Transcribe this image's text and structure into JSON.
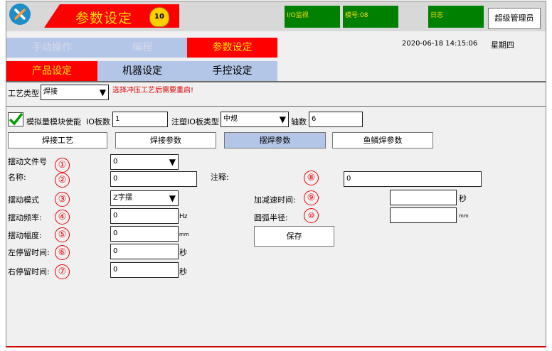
{
  "header": {
    "title": "参数设定",
    "badge_text": "10",
    "io_monitor": "I/O监视",
    "model_no": "模号:08",
    "log": "日志",
    "admin": "超级管理员",
    "datetime": "2020-06-18  14:15:06",
    "weekday": "星期四"
  },
  "main_tabs": [
    "手动操作",
    "编程",
    "参数设定"
  ],
  "sub_tabs": [
    "产品设定",
    "机器设定",
    "手控设定"
  ],
  "process": {
    "label": "工艺类型",
    "value": "焊接",
    "warning": "选择冲压工艺后需要重启!"
  },
  "options": {
    "sim_label": "模拟量模块使能",
    "io_count_label": "IO板数",
    "io_count_value": "1",
    "injection_label": "注塑IO板类型",
    "injection_value": "中规",
    "axis_label": "轴数",
    "axis_value": "6"
  },
  "func_tabs": [
    "焊接工艺",
    "焊接参数",
    "摆焊参数",
    "鱼鳞焊参数"
  ],
  "form": {
    "file_no_label": "摆动文件号",
    "file_no_value": "0",
    "name_label": "名称:",
    "name_value": "0",
    "mode_label": "摆动模式",
    "mode_value": "Z字摆",
    "freq_label": "摆动频率:",
    "freq_value": "0",
    "freq_unit": "Hz",
    "amp_label": "摆动幅度:",
    "amp_value": "0",
    "amp_unit": "mm",
    "left_label": "左停留时间:",
    "left_value": "0",
    "left_unit": "秒",
    "right_label": "右停留时间:",
    "right_value": "0",
    "right_unit": "秒",
    "note_label": "注释:",
    "note_value": "0",
    "accel_label": "加减速时间:",
    "accel_value": "",
    "accel_unit": "秒",
    "radius_label": "圆弧半径:",
    "radius_value": "",
    "radius_unit": "mm",
    "save": "保存"
  },
  "markers": [
    "①",
    "②",
    "③",
    "④",
    "⑤",
    "⑥",
    "⑦",
    "⑧",
    "⑨",
    "⑩"
  ],
  "colors": {
    "accent_red": "#ff0000",
    "tab_blue": "#b4c6e7",
    "green": "#008000",
    "warn_red": "#e00000"
  }
}
